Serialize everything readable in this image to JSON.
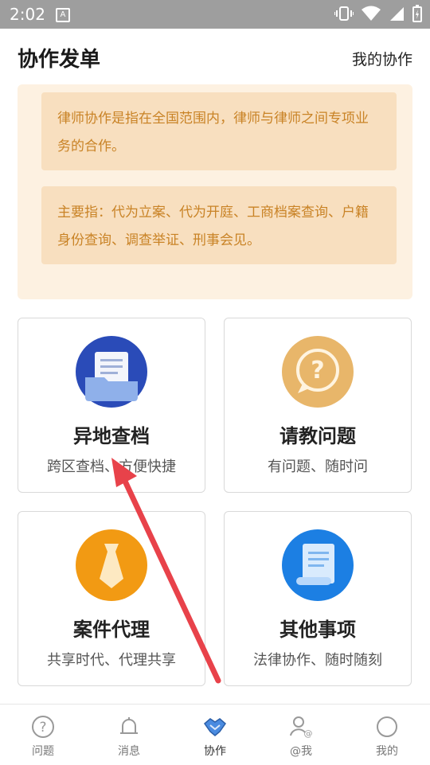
{
  "status_bar": {
    "time": "2:02",
    "badge": "A"
  },
  "header": {
    "title": "协作发单",
    "my_collab": "我的协作"
  },
  "intro": {
    "line1": "律师协作是指在全国范围内，律师与律师之间专项业务的合作。",
    "line2": "主要指：代为立案、代为开庭、工商档案查询、户籍身份查询、调查举证、刑事会见。"
  },
  "tiles": [
    {
      "title": "异地查档",
      "subtitle": "跨区查档、方便快捷",
      "icon": "folder-document-icon",
      "color": "#2a4bb8"
    },
    {
      "title": "请教问题",
      "subtitle": "有问题、随时问",
      "icon": "question-bubble-icon",
      "color": "#e8b66a"
    },
    {
      "title": "案件代理",
      "subtitle": "共享时代、代理共享",
      "icon": "tie-icon",
      "color": "#f29a13"
    },
    {
      "title": "其他事项",
      "subtitle": "法律协作、随时随刻",
      "icon": "scroll-document-icon",
      "color": "#1c7fe3"
    }
  ],
  "tabbar": {
    "items": [
      {
        "label": "问题",
        "icon": "question-circle-icon"
      },
      {
        "label": "消息",
        "icon": "bell-icon"
      },
      {
        "label": "协作",
        "icon": "handshake-icon",
        "active": true
      },
      {
        "label": "@我",
        "icon": "user-at-icon"
      },
      {
        "label": "我的",
        "icon": "profile-circle-icon"
      }
    ]
  },
  "colors": {
    "accent_orange": "#c98326",
    "intro_bg": "#fdf1e1",
    "arrow": "#e8424a"
  }
}
